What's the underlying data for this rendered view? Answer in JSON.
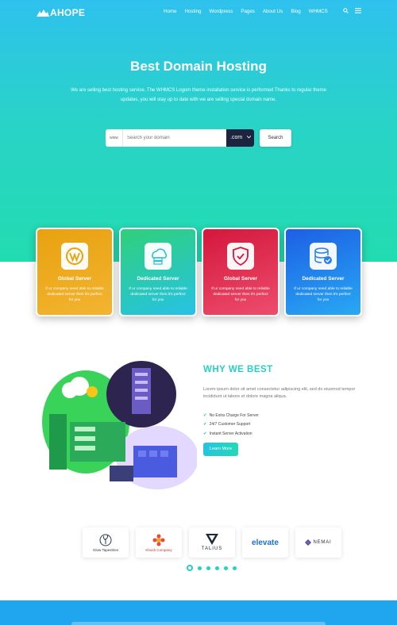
{
  "brand": {
    "name": "AHOPE"
  },
  "nav": {
    "items": [
      "Home",
      "Hosting",
      "Wordpress",
      "Pages",
      "About Us",
      "Blog",
      "WHMCS"
    ]
  },
  "hero": {
    "title": "Best Domain Hosting",
    "subtitle": "We are selling best hosting service. The WHMCS Logom theme installation service is performed Thanks to regular theme updates, you will stay up to date with we are selling special domain name.",
    "search": {
      "prefix": "www",
      "placeholder": "Search your domain",
      "tld": ".com",
      "button": "Search"
    }
  },
  "cards": [
    {
      "title": "Global Server",
      "text": "If ur company need able to reliable dedicated server then it's perfect for you",
      "icon": "wordpress-icon",
      "color_from": "#e8a210",
      "color_to": "#f0b12a"
    },
    {
      "title": "Dedicated Server",
      "text": "If ur company need able to reliable dedicated server then it's perfect for you",
      "icon": "cloud-server-icon",
      "color_from": "#2fcf7d",
      "color_to": "#28c3e8"
    },
    {
      "title": "Global Server",
      "text": "If ur company need able to reliable dedicated server then it's perfect for you",
      "icon": "shield-check-icon",
      "color_from": "#d3183c",
      "color_to": "#ef4a6a"
    },
    {
      "title": "Dedicated Server",
      "text": "If ur company need able to reliable dedicated server then it's perfect for you",
      "icon": "database-check-icon",
      "color_from": "#1d62e6",
      "color_to": "#27a9f3"
    }
  ],
  "why": {
    "title": "WHY WE BEST",
    "text": "Lorem ipsum dolor sit amet consectetur adipiscing elit, sed do eiusmod tempor incididunt ut labore et dolore magna aliqua.",
    "list": [
      "No Extra Charge For Server",
      "24/7 Customer Support",
      "Instant Server Activation"
    ],
    "button": "Learn More"
  },
  "partners": [
    {
      "name": "Glow Tapestries",
      "icon": "plant-logo-icon"
    },
    {
      "name": "Khush Company",
      "icon": "flower-logo-icon"
    },
    {
      "name": "TALIUS",
      "icon": "triangle-logo-icon"
    },
    {
      "name": "elevate",
      "icon": "elevate-logo"
    },
    {
      "name": "NEMAI",
      "icon": "nemai-logo-icon"
    }
  ],
  "colors": {
    "accent": "#25d0c4",
    "dark": "#1c2440",
    "footer": "#1fa6ef"
  }
}
